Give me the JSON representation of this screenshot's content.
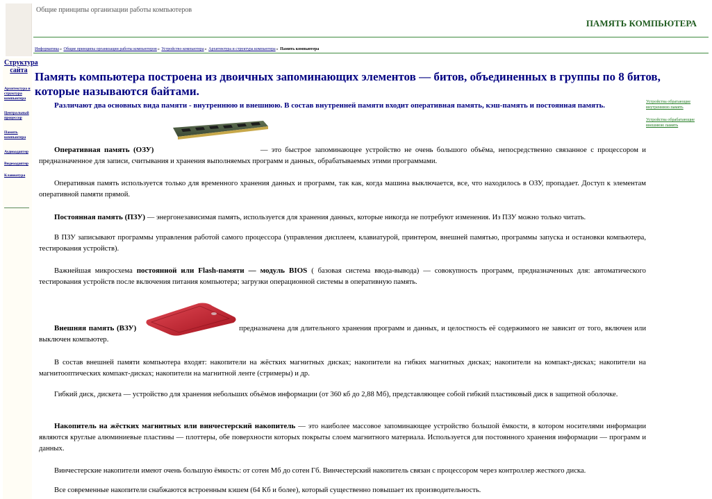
{
  "header": {
    "top_caption": "Общие принципы организации работы компьютеров",
    "page_title": "ПАМЯТЬ КОМПЬЮТЕРА"
  },
  "breadcrumb": {
    "items": [
      "Информатика",
      "Общие принципы организации работы компьютеров",
      "Устройство компьютера",
      "Архитектура и структура компьютера"
    ],
    "separator": "»",
    "current": "Память компьютера"
  },
  "sidebar": {
    "main": "Структура сайта",
    "items": [
      "Архитектура и структура компьютера",
      "Центральный процессор",
      "Память компьютера",
      "Аудиоадаптер",
      "Видеоадаптер",
      "Клавиатура"
    ]
  },
  "right_links": [
    "Устройства обратающие внутреннюю память",
    "Устройства обрабатающие внешнюю память"
  ],
  "headline": "Память компьютера построена из двоичных запоминающих элементов — битов, объединенных в группы по 8 битов, которые называются байтами.",
  "subhead": "Различают два основных вида памяти - внутреннюю и внешнюю. В состав внутренней памяти входит оперативная память, кэш-память и постоянная память.",
  "paragraphs": {
    "ram_term": "Оперативная память (ОЗУ)",
    "ram_text": " — это быстрое запоминающее устройство не очень большого объёма, непосредственно связанное с процессором и предназначенное для записи, считывания и хранения выполняемых программ и данных, обрабатываемых этими программами.",
    "ram_usage": "Оперативная память используется только для временного хранения данных и программ, так как, когда машина выключается, все, что находилось в ОЗУ, пропадает. Доступ к элементам оперативной памяти прямой.",
    "rom_term": "Постоянная память (ПЗУ)",
    "rom_text": " — энергонезависимая память, используется для хранения данных, которые никогда не потребуют изменения. Из ПЗУ можно только читать.",
    "rom_programs": "В ПЗУ записывают программы управления работой самого процессора (управления дисплеем, клавиатурой, принтером, внешней памятью, программы запуска и остановки компьютера, тестирования устройств).",
    "bios_pre": "Важнейшая микросхема ",
    "bios_term": "постоянной или Flash-памяти — модуль BIOS",
    "bios_text": " ( базовая система ввода-вывода) — совокупность программ, предназначенных для: автоматического тестирования устройств после включения питания компьютера; загрузки операционной системы в оперативную память.",
    "ext_term": "Внешняя память (ВЗУ)",
    "ext_text": "предназначена для длительного хранения программ и данных, и целостность её содержимого не зависит от того, включен или выключен компьютер.",
    "ext_devices": "В состав внешней памяти компьютера входят: накопители на жёстких магнитных дисках; накопители на гибких магнитных дисках; накопители на компакт-дисках; накопители на магнитооптических компакт-дисках; накопители на магнитной ленте (стримеры) и др.",
    "floppy": "Гибкий диск, дискета — устройство для хранения небольших объёмов информации (от 360 кб до 2,88 Мб), представляющее собой гибкий пластиковый диск в защитной оболочке.",
    "hdd_term": "Накопитель на жёстких магнитных или винчестерский накопитель",
    "hdd_text": " — это наиболее массовое запоминающее устройство большой ёмкости, в котором носителями информации являются круглые алюминиевые пластины — плоттеры, обе поверхности которых покрыты слоем магнитного материала. Используется для постоянного хранения информации — программ и данных.",
    "hdd_capacity": "Винчестерские накопители имеют очень большую ёмкость: от сотен Мб до сотен Гб. Винчестерский накопитель связан с процессором через контроллер жесткого диска.",
    "hdd_cache": "Все современные накопители снабжаются встроенным кэшем (64 Кб и более), который существенно повышает их производительность."
  }
}
